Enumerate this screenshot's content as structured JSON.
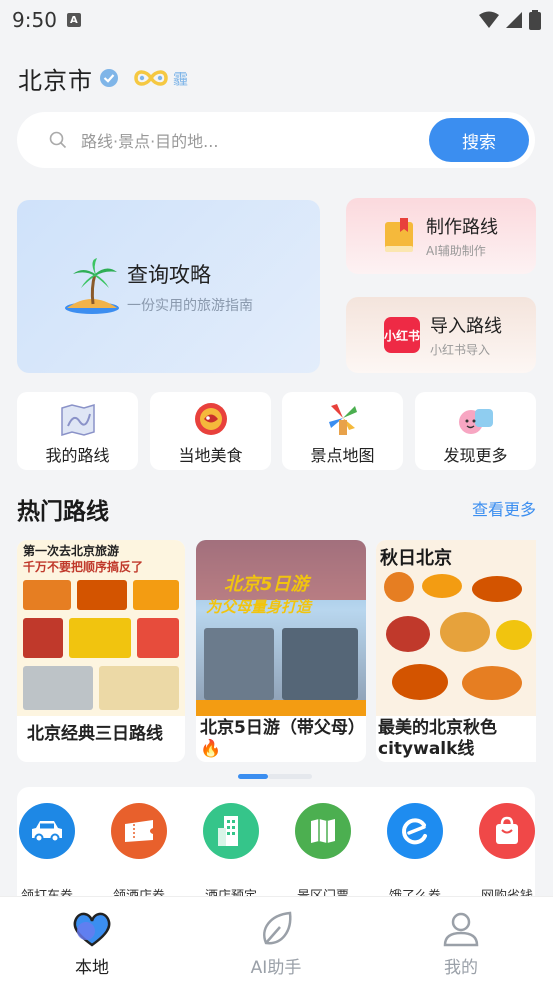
{
  "status_bar": {
    "time": "9:50",
    "notification_glyph": "A"
  },
  "header": {
    "city": "北京市",
    "sync_text": "霾"
  },
  "search": {
    "placeholder": "路线·景点·目的地...",
    "button": "搜索"
  },
  "cards": {
    "guide": {
      "title": "查询攻略",
      "subtitle": "一份实用的旅游指南"
    },
    "make_route": {
      "title": "制作路线",
      "subtitle": "AI辅助制作"
    },
    "import_route": {
      "title": "导入路线",
      "subtitle": "小红书导入",
      "logo_text": "小红书"
    }
  },
  "quick_actions": [
    {
      "label": "我的路线",
      "icon": "route-map-icon"
    },
    {
      "label": "当地美食",
      "icon": "food-icon"
    },
    {
      "label": "景点地图",
      "icon": "windmill-icon"
    },
    {
      "label": "发现更多",
      "icon": "discover-icon"
    }
  ],
  "hot_routes": {
    "title": "热门路线",
    "more": "查看更多",
    "items": [
      {
        "caption": "北京经典三日路线",
        "thumb_line1": "第一次去北京旅游",
        "thumb_line2": "千万不要把顺序搞反了"
      },
      {
        "caption": "北京5日游（带父母）🔥",
        "thumb_line1": "北京5日游",
        "thumb_line2": "为父母量身打造"
      },
      {
        "caption": "最美的北京秋色citywalk线",
        "thumb_line1": "秋日北京",
        "thumb_line2": ""
      }
    ]
  },
  "coupons": [
    {
      "label": "领打车券",
      "color": "#1e88e5",
      "icon": "car-icon"
    },
    {
      "label": "领酒店券",
      "color": "#e8602c",
      "icon": "ticket-icon"
    },
    {
      "label": "酒店预定",
      "color": "#35c58a",
      "icon": "hotel-icon"
    },
    {
      "label": "景区门票",
      "color": "#4caf50",
      "icon": "map-book-icon"
    },
    {
      "label": "饿了么券",
      "color": "#1e8cf0",
      "icon": "eleme-icon"
    },
    {
      "label": "网购省钱",
      "color": "#f04848",
      "icon": "shopping-bag-icon"
    }
  ],
  "tabs": [
    {
      "label": "本地",
      "active": true
    },
    {
      "label": "AI助手",
      "active": false
    },
    {
      "label": "我的",
      "active": false
    }
  ],
  "colors": {
    "accent": "#3b8ef0",
    "active_tab": "#222222",
    "inactive_tab": "#9aa0a8"
  }
}
